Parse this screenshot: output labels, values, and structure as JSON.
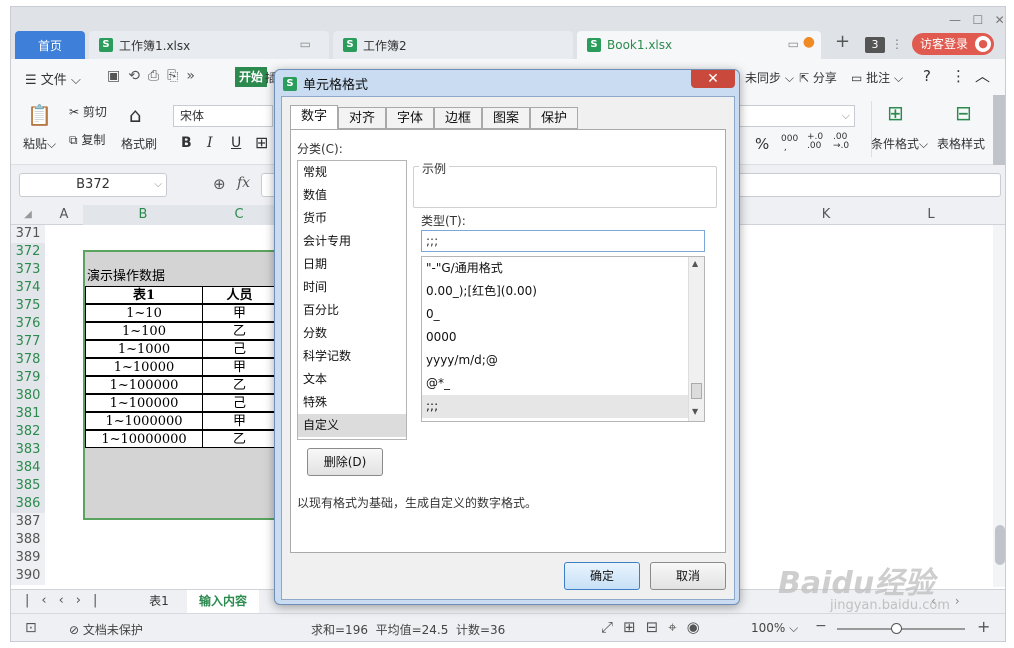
{
  "window_tabs": [
    {
      "label": "首页"
    },
    {
      "label": "工作簿1.xlsx"
    },
    {
      "label": "工作簿2"
    },
    {
      "label": "Book1.xlsx"
    }
  ],
  "tab_count": "3",
  "login_label": "访客登录",
  "menu": {
    "file": "文件",
    "start": "开始",
    "insert_partial": "插",
    "sync": "未同步",
    "share": "分享",
    "comment": "批注",
    "help": "?"
  },
  "ribbon": {
    "paste": "粘贴",
    "cut": "剪切",
    "copy": "复制",
    "format_painter": "格式刷",
    "font_name": "宋体",
    "bold": "B",
    "italic": "I",
    "underline": "U",
    "percent": "%",
    "cond_format": "条件格式",
    "table_style": "表格样式"
  },
  "formula_bar": {
    "name_box": "B372",
    "fx": "fx"
  },
  "columns": [
    "A",
    "B",
    "C",
    "K",
    "L"
  ],
  "row_numbers": [
    "371",
    "372",
    "373",
    "374",
    "375",
    "376",
    "377",
    "378",
    "379",
    "380",
    "381",
    "382",
    "383",
    "384",
    "385",
    "386",
    "387",
    "388",
    "389",
    "390"
  ],
  "sheet_cells": {
    "title": "演示操作数据",
    "header_col1": "表1",
    "header_col2": "人员",
    "rows": [
      {
        "c1": "1~10",
        "c2": "甲"
      },
      {
        "c1": "1~100",
        "c2": "乙"
      },
      {
        "c1": "1~1000",
        "c2": "己"
      },
      {
        "c1": "1~10000",
        "c2": "甲"
      },
      {
        "c1": "1~100000",
        "c2": "乙"
      },
      {
        "c1": "1~100000",
        "c2": "己"
      },
      {
        "c1": "1~1000000",
        "c2": "甲"
      },
      {
        "c1": "1~10000000",
        "c2": "乙"
      }
    ]
  },
  "sheet_tabs": [
    "表1",
    "输入内容"
  ],
  "status": {
    "protect": "文档未保护",
    "summary": "求和=196  平均值=24.5  计数=36",
    "zoom": "100%"
  },
  "dialog": {
    "title": "单元格格式",
    "close": "✕",
    "tabs": [
      "数字",
      "对齐",
      "字体",
      "边框",
      "图案",
      "保护"
    ],
    "category_label": "分类(C):",
    "categories": [
      "常规",
      "数值",
      "货币",
      "会计专用",
      "日期",
      "时间",
      "百分比",
      "分数",
      "科学记数",
      "文本",
      "特殊",
      "自定义"
    ],
    "sample_label": "示例",
    "type_label": "类型(T):",
    "type_value": ";;;",
    "formats": [
      "\"-\"G/通用格式",
      "0.00_);[红色](0.00)",
      "0_",
      "0000",
      "yyyy/m/d;@",
      "@*_",
      ";;;"
    ],
    "delete_button": "删除(D)",
    "description": "以现有格式为基础，生成自定义的数字格式。",
    "ok": "确定",
    "cancel": "取消"
  },
  "watermark": {
    "brand": "Baidu经验",
    "url": "jingyan.baidu.com"
  },
  "colors": {
    "accent_blue": "#3d7fd9",
    "sheet_green": "#5aa45f",
    "annotation_red": "#e02020",
    "login_red": "#e05a4f"
  }
}
